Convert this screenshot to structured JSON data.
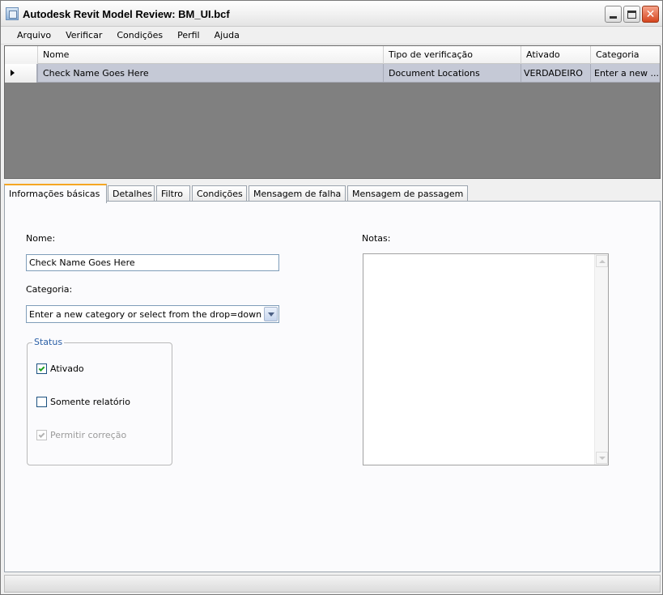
{
  "window": {
    "title": "Autodesk Revit Model Review: BM_UI.bcf"
  },
  "menu": {
    "items": [
      "Arquivo",
      "Verificar",
      "Condições",
      "Perfil",
      "Ajuda"
    ]
  },
  "grid": {
    "columns": [
      "Nome",
      "Tipo de verificação",
      "Ativado",
      "Categoria"
    ],
    "rows": [
      [
        "Check Name Goes Here",
        "Document Locations",
        "VERDADEIRO",
        "Enter a new ..."
      ]
    ]
  },
  "tabs": [
    "Informações básicas",
    "Detalhes",
    "Filtro",
    "Condições",
    "Mensagem de falha",
    "Mensagem de passagem"
  ],
  "form": {
    "name_label": "Nome:",
    "name_value": "Check Name Goes Here",
    "category_label": "Categoria:",
    "category_value": "Enter a new category or select from the drop=down li",
    "notes_label": "Notas:",
    "notes_value": "",
    "status": {
      "title": "Status",
      "options": [
        {
          "label": "Ativado",
          "checked": true,
          "enabled": true
        },
        {
          "label": "Somente relatório",
          "checked": false,
          "enabled": true
        },
        {
          "label": "Permitir correção",
          "checked": true,
          "enabled": false
        }
      ]
    }
  },
  "colors": {
    "selected_row": "#c5c9d6",
    "grid_background": "#808080",
    "active_tab_accent": "#f5a623",
    "group_title": "#2a5fa6"
  },
  "icons": {
    "app": "app-icon",
    "minimize": "minimize-icon",
    "maximize": "maximize-icon",
    "close": "close-icon",
    "row_selector": "row-selector-arrow-icon",
    "dropdown": "chevron-down-icon"
  }
}
